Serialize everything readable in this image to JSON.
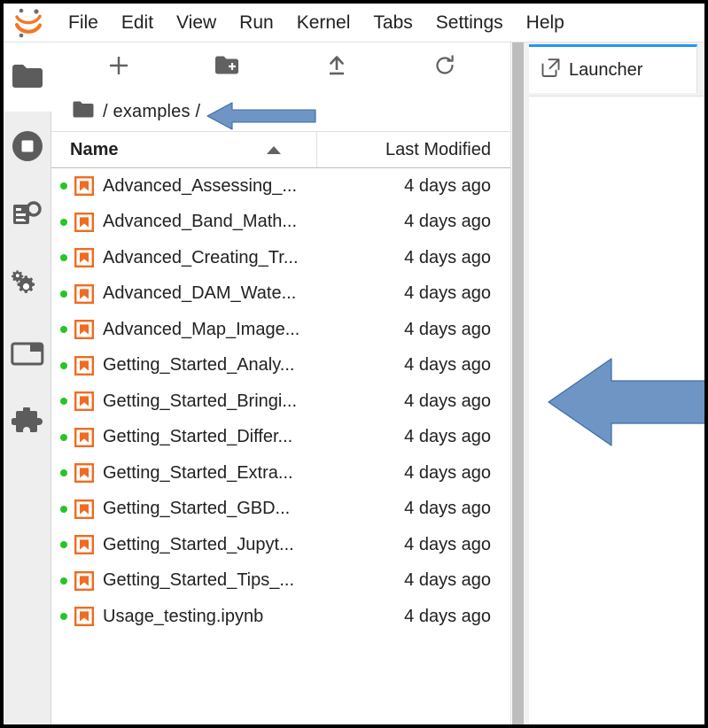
{
  "app": {
    "logo": "jupyter-logo",
    "menu": [
      "File",
      "Edit",
      "View",
      "Run",
      "Kernel",
      "Tabs",
      "Settings",
      "Help"
    ]
  },
  "sidebar": {
    "items": [
      {
        "icon": "folder-icon",
        "label": "File Browser",
        "active": true
      },
      {
        "icon": "stop-circle-icon",
        "label": "Running Terminals and Kernels",
        "active": false
      },
      {
        "icon": "search-code-icon",
        "label": "Table of Contents",
        "active": false
      },
      {
        "icon": "gears-icon",
        "label": "Property Inspector",
        "active": false
      },
      {
        "icon": "window-icon",
        "label": "Open Tabs",
        "active": false
      },
      {
        "icon": "puzzle-icon",
        "label": "Extension Manager",
        "active": false
      }
    ]
  },
  "filebrowser": {
    "toolbar": [
      {
        "icon": "plus-icon",
        "label": "New Launcher"
      },
      {
        "icon": "new-folder-icon",
        "label": "New Folder"
      },
      {
        "icon": "upload-icon",
        "label": "Upload Files"
      },
      {
        "icon": "refresh-icon",
        "label": "Refresh File List"
      }
    ],
    "breadcrumb": {
      "icon": "folder-icon",
      "path": "/ examples /"
    },
    "columns": {
      "name": "Name",
      "last_modified": "Last Modified",
      "sort": "ascending"
    },
    "colors": {
      "notebook_icon": "#ef6c21",
      "running_dot": "#25c525"
    },
    "files": [
      {
        "name": "Advanced_Assessing_...",
        "modified": "4 days ago",
        "running": true,
        "kind": "notebook"
      },
      {
        "name": "Advanced_Band_Math...",
        "modified": "4 days ago",
        "running": true,
        "kind": "notebook"
      },
      {
        "name": "Advanced_Creating_Tr...",
        "modified": "4 days ago",
        "running": true,
        "kind": "notebook"
      },
      {
        "name": "Advanced_DAM_Wate...",
        "modified": "4 days ago",
        "running": true,
        "kind": "notebook"
      },
      {
        "name": "Advanced_Map_Image...",
        "modified": "4 days ago",
        "running": true,
        "kind": "notebook"
      },
      {
        "name": "Getting_Started_Analy...",
        "modified": "4 days ago",
        "running": true,
        "kind": "notebook"
      },
      {
        "name": "Getting_Started_Bringi...",
        "modified": "4 days ago",
        "running": true,
        "kind": "notebook"
      },
      {
        "name": "Getting_Started_Differ...",
        "modified": "4 days ago",
        "running": true,
        "kind": "notebook"
      },
      {
        "name": "Getting_Started_Extra...",
        "modified": "4 days ago",
        "running": true,
        "kind": "notebook"
      },
      {
        "name": "Getting_Started_GBD...",
        "modified": "4 days ago",
        "running": true,
        "kind": "notebook"
      },
      {
        "name": "Getting_Started_Jupyt...",
        "modified": "4 days ago",
        "running": true,
        "kind": "notebook"
      },
      {
        "name": "Getting_Started_Tips_...",
        "modified": "4 days ago",
        "running": true,
        "kind": "notebook"
      },
      {
        "name": "Usage_testing.ipynb",
        "modified": "4 days ago",
        "running": true,
        "kind": "notebook"
      }
    ]
  },
  "dock": {
    "tabs": [
      {
        "label": "Launcher",
        "icon": "launcher-icon",
        "active": true
      }
    ],
    "active_accent": "#2196f3"
  },
  "annotations": {
    "color": "#6e95c4",
    "outline": "#3d6ca6",
    "arrows": [
      {
        "name": "arrow-pointing-to-breadcrumb",
        "direction": "left"
      },
      {
        "name": "arrow-pointing-to-main-area",
        "direction": "left"
      }
    ]
  }
}
